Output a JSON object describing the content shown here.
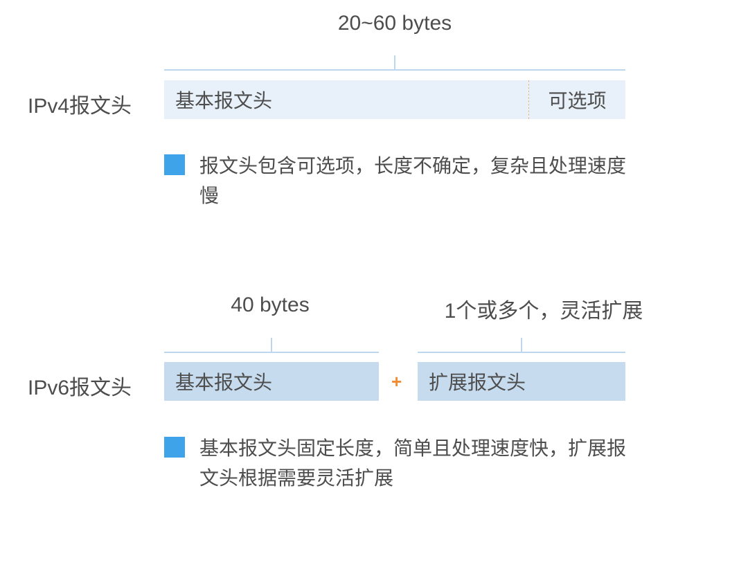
{
  "ipv4": {
    "row_label": "IPv4报文头",
    "size_label": "20~60 bytes",
    "seg_basic": "基本报文头",
    "seg_optional": "可选项",
    "bullet": "报文头包含可选项，长度不确定，复杂且处理速度慢"
  },
  "ipv6": {
    "row_label": "IPv6报文头",
    "size_basic": "40 bytes",
    "size_ext": "1个或多个，灵活扩展",
    "seg_basic": "基本报文头",
    "plus": "+",
    "seg_ext": "扩展报文头",
    "bullet": "基本报文头固定长度，简单且处理速度快，扩展报文头根据需要灵活扩展"
  }
}
